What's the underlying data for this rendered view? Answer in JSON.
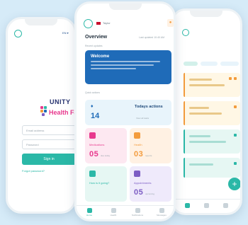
{
  "login_screen": {
    "language": "EN ▾",
    "brand_line1": "UNITY",
    "brand_line2": "Health Fact",
    "username_placeholder": "Email address",
    "password_placeholder": "Password",
    "signin_label": "Sign in",
    "forgot_label": "Forgot password?"
  },
  "dashboard": {
    "header_user": "Taylor",
    "title": "Overview",
    "date": "Last updated 10:40 AM",
    "recent_section": "Recent updates",
    "welcome_title": "Welcome",
    "quick_section": "Quick actions",
    "today_title": "Todays actions",
    "today_value": "14",
    "today_meta": "View all tasks",
    "tiles": [
      {
        "label": "Medications",
        "value": "05",
        "sub": "due today",
        "color": "#e8398e",
        "bg": "#fde8f1"
      },
      {
        "label": "Health",
        "value": "03",
        "sub": "reports",
        "color": "#f39c3d",
        "bg": "#fff1e3"
      },
      {
        "label": "How is it going?",
        "value": "",
        "sub": "",
        "color": "#2bb8a7",
        "bg": "#e6f7f3"
      },
      {
        "label": "Appointments",
        "value": "05",
        "sub": "upcoming",
        "color": "#7c5cc4",
        "bg": "#efeafb"
      }
    ],
    "nav": [
      "Home",
      "Health",
      "Notifications",
      "Messages"
    ]
  },
  "colors": {
    "accent": "#2bb8a7",
    "primary": "#1f6bb8",
    "brand_pink": "#e8398e",
    "warning": "#f39c3d"
  }
}
